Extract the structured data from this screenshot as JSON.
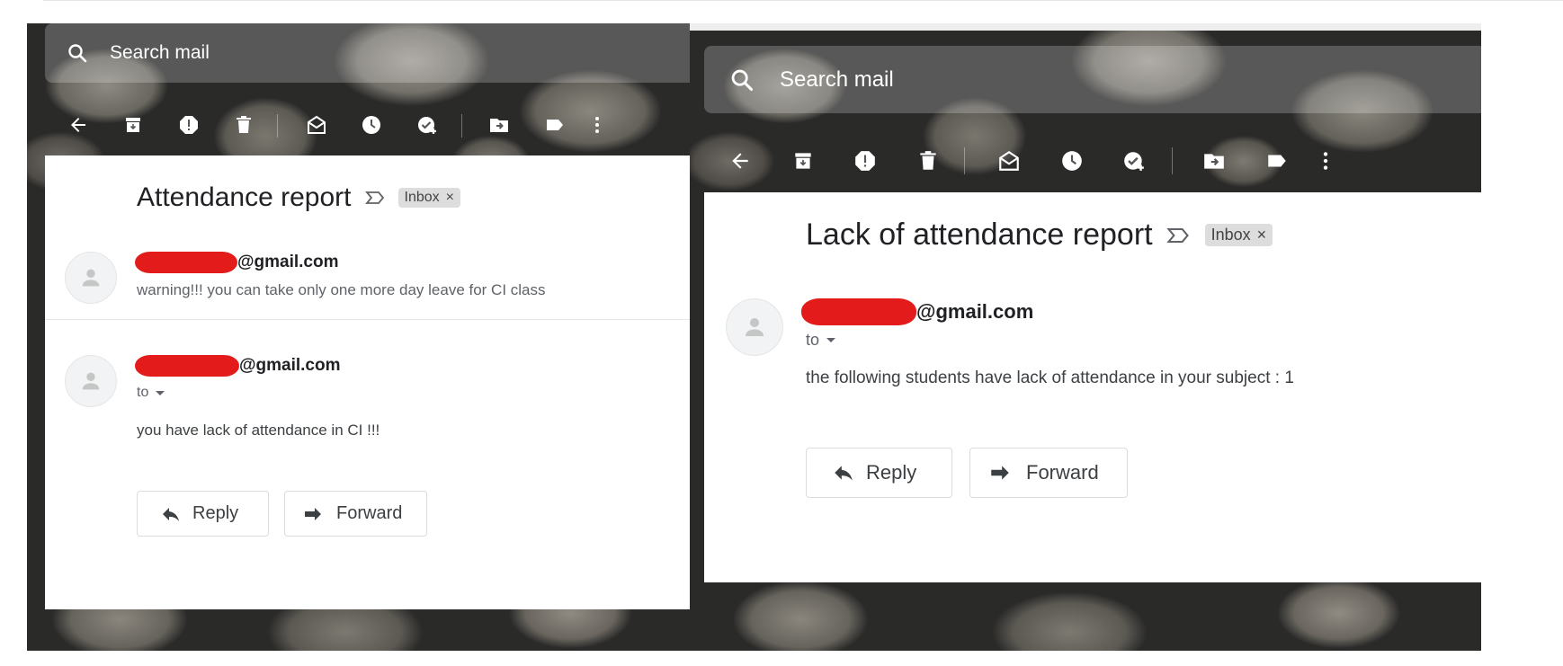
{
  "search_placeholder": "Search mail",
  "left": {
    "subject": "Attendance report",
    "badge": "Inbox",
    "badge_close": "×",
    "message1": {
      "sender_partial": "@gmail.com",
      "snippet": "warning!!! you can take only one more day leave for CI class"
    },
    "message2": {
      "sender_partial": "@gmail.com",
      "to_label": "to",
      "body": "you have lack of attendance in CI !!!"
    },
    "reply_label": "Reply",
    "forward_label": "Forward"
  },
  "right": {
    "subject": "Lack of attendance report",
    "badge": "Inbox",
    "badge_close": "×",
    "message": {
      "sender_partial": "@gmail.com",
      "to_label": "to",
      "body": "the following students have lack of attendance in your subject : 1"
    },
    "reply_label": "Reply",
    "forward_label": "Forward"
  },
  "toolbar_icons": [
    "back-arrow-icon",
    "archive-icon",
    "report-spam-icon",
    "delete-icon",
    "mark-unread-icon",
    "snooze-icon",
    "add-to-tasks-icon",
    "move-to-icon",
    "label-icon",
    "more-options-icon"
  ],
  "colors": {
    "redaction": "#e31b1b",
    "badge_bg": "#dddddd",
    "text": "#202124"
  }
}
